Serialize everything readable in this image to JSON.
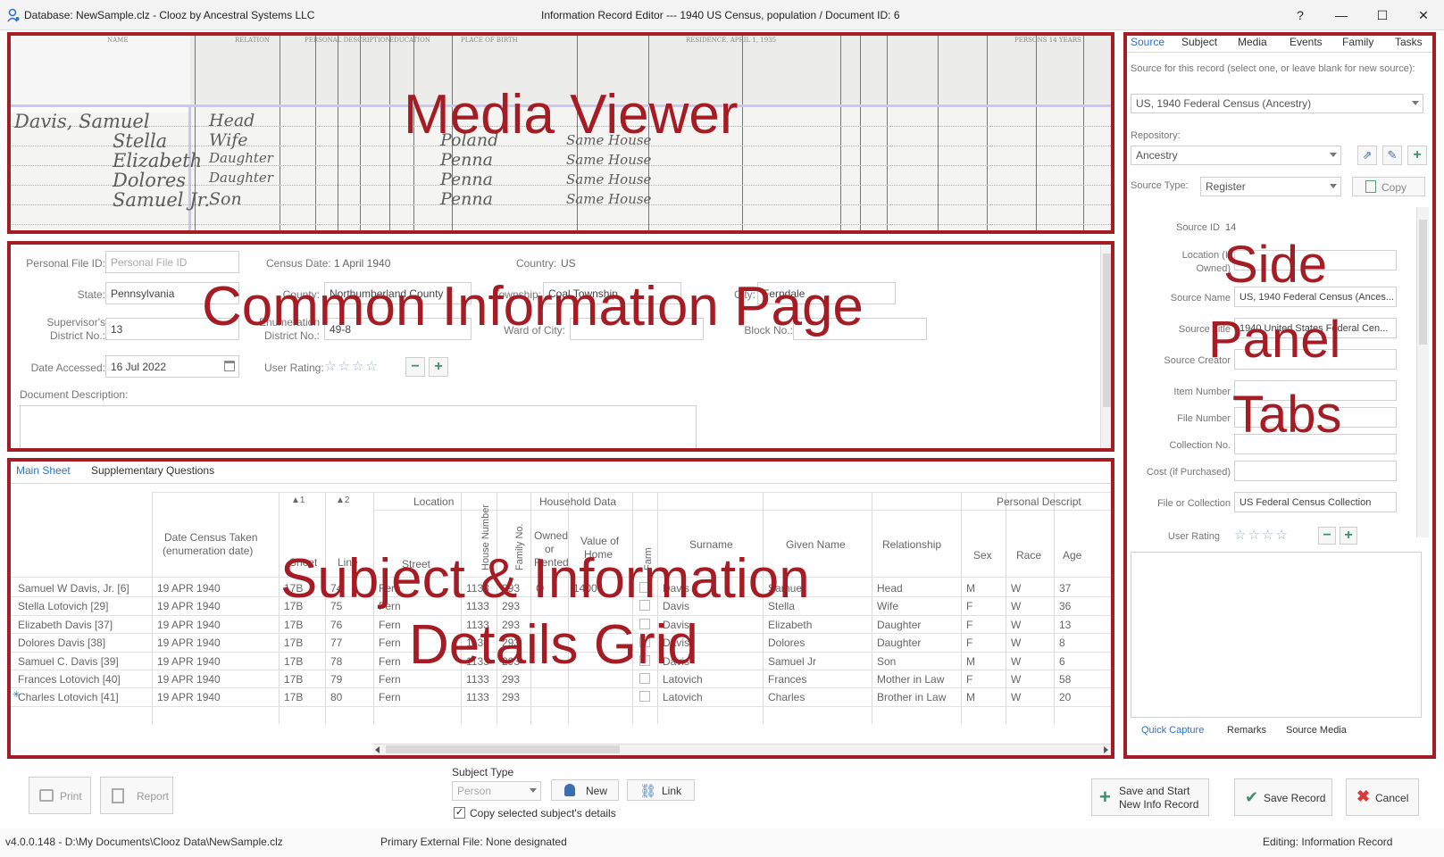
{
  "window": {
    "left_title": "Database: NewSample.clz - Clooz by Ancestral Systems LLC",
    "center_title": "Information Record Editor --- 1940 US Census, population /  Document ID: 6",
    "help": "?",
    "minimize": "—",
    "maximize": "☐",
    "close": "✕"
  },
  "overlays": {
    "media_viewer": "Media Viewer",
    "common_info": "Common Information Page",
    "grid_line1": "Subject & Information",
    "grid_line2": "Details Grid",
    "side_line1": "Side",
    "side_line2": "Panel",
    "side_line3": "Tabs"
  },
  "census_image": {
    "headers": [
      "NAME",
      "RELATION",
      "PERSONAL DESCRIPTION",
      "EDUCATION",
      "PLACE OF BIRTH",
      "RESIDENCE, APRIL 1, 1935",
      "PERSONS 14 YEARS"
    ],
    "handwriting": [
      "Davis, Samuel",
      "Stella",
      "Elizabeth",
      "Dolores",
      "Samuel Jr.",
      "Head",
      "Wife",
      "Daughter",
      "Daughter",
      "Son",
      "Poland",
      "Penna",
      "Penna",
      "Penna",
      "Same House",
      "Same House",
      "Same House",
      "Same House"
    ]
  },
  "common": {
    "personal_file_label": "Personal File ID:",
    "personal_file_placeholder": "Personal File ID",
    "census_date_label": "Census Date:",
    "census_date_value": "1 April 1940",
    "country_label": "Country:",
    "country_value": "US",
    "state_label": "State:",
    "state_value": "Pennsylvania",
    "county_label": "County:",
    "county_value": "Northumberland County",
    "township_label": "Township:",
    "township_value": "Coal Township",
    "city_label": "City:",
    "city_value": "Ferndale",
    "supervisor_label1": "Supervisor's",
    "supervisor_label2": "District No.:",
    "supervisor_value": "13",
    "enum_label1": "Enumeration",
    "enum_label2": "District No.:",
    "enum_value": "49-8",
    "ward_label": "Ward of City:",
    "block_label": "Block No.:",
    "date_accessed_label": "Date Accessed:",
    "date_accessed_value": "16 Jul 2022",
    "user_rating_label": "User Rating:",
    "rating_stars": "☆☆☆☆",
    "doc_desc_label": "Document Description:"
  },
  "grid": {
    "tabs": [
      "Main Sheet",
      "Supplementary Questions"
    ],
    "group_headers": {
      "location": "Location",
      "household": "Household Data",
      "personal": "Personal Descript"
    },
    "sort_sheet": "▲1",
    "sort_line": "▲2",
    "headers": {
      "date1": "Date Census Taken",
      "date2": "(enumeration date)",
      "sheet": "Sheet",
      "line": "Line",
      "street": "Street",
      "house_number": "House Number",
      "family_no": "Family No.",
      "owned1": "Owned",
      "owned2": "or",
      "owned3": "Rented",
      "value1": "Value of",
      "value2": "Home",
      "farm": "Farm",
      "surname": "Surname",
      "given": "Given Name",
      "relationship": "Relationship",
      "sex": "Sex",
      "race": "Race",
      "age": "Age"
    },
    "rows": [
      {
        "subject": "Samuel W Davis, Jr.  [6]",
        "date": "19 APR 1940",
        "sheet": "17B",
        "line": "74",
        "street": "Fern",
        "house": "1133",
        "family": "293",
        "owned": "O",
        "value": "1400",
        "surname": "Davis",
        "given": "Samuel",
        "relationship": "Head",
        "sex": "M",
        "race": "W",
        "age": "37"
      },
      {
        "subject": "Stella Lotovich  [29]",
        "date": "19 APR 1940",
        "sheet": "17B",
        "line": "75",
        "street": "Fern",
        "house": "1133",
        "family": "293",
        "owned": "",
        "value": "",
        "surname": "Davis",
        "given": "Stella",
        "relationship": "Wife",
        "sex": "F",
        "race": "W",
        "age": "36"
      },
      {
        "subject": "Elizabeth Davis  [37]",
        "date": "19 APR 1940",
        "sheet": "17B",
        "line": "76",
        "street": "Fern",
        "house": "1133",
        "family": "293",
        "owned": "",
        "value": "",
        "surname": "Davis",
        "given": "Elizabeth",
        "relationship": "Daughter",
        "sex": "F",
        "race": "W",
        "age": "13"
      },
      {
        "subject": "Dolores Davis  [38]",
        "date": "19 APR 1940",
        "sheet": "17B",
        "line": "77",
        "street": "Fern",
        "house": "1133",
        "family": "293",
        "owned": "",
        "value": "",
        "surname": "Davis",
        "given": "Dolores",
        "relationship": "Daughter",
        "sex": "F",
        "race": "W",
        "age": "8"
      },
      {
        "subject": "Samuel C. Davis  [39]",
        "date": "19 APR 1940",
        "sheet": "17B",
        "line": "78",
        "street": "Fern",
        "house": "1133",
        "family": "293",
        "owned": "",
        "value": "",
        "surname": "Davis",
        "given": "Samuel Jr",
        "relationship": "Son",
        "sex": "M",
        "race": "W",
        "age": "6"
      },
      {
        "subject": "Frances Lotovich  [40]",
        "date": "19 APR 1940",
        "sheet": "17B",
        "line": "79",
        "street": "Fern",
        "house": "1133",
        "family": "293",
        "owned": "",
        "value": "",
        "surname": "Latovich",
        "given": "Frances",
        "relationship": "Mother in Law",
        "sex": "F",
        "race": "W",
        "age": "58"
      },
      {
        "subject": "Charles Lotovich  [41]",
        "date": "19 APR 1940",
        "sheet": "17B",
        "line": "80",
        "street": "Fern",
        "house": "1133",
        "family": "293",
        "owned": "",
        "value": "",
        "surname": "Latovich",
        "given": "Charles",
        "relationship": "Brother in Law",
        "sex": "M",
        "race": "W",
        "age": "20"
      }
    ]
  },
  "side": {
    "tabs": [
      "Source",
      "Subject",
      "Media",
      "Events",
      "Family",
      "Tasks"
    ],
    "source_prompt": "Source for this record (select one, or leave blank for new source):",
    "source_value": "US, 1940 Federal Census (Ancestry)",
    "repository_label": "Repository:",
    "repository_value": "Ancestry",
    "source_type_label": "Source Type:",
    "source_type_value": "Register",
    "copy_label": "Copy",
    "source_id_label": "Source ID",
    "source_id_value": "14",
    "location_label1": "Location (If",
    "location_label2": "Owned)",
    "source_name_label": "Source Name",
    "source_name_value": "US, 1940 Federal Census (Ances...",
    "source_title_label": "Source Title",
    "source_title_value": "1940 United States Federal Cen...",
    "source_creator_label": "Source Creator",
    "item_number_label": "Item Number",
    "file_number_label": "File Number",
    "collection_label": "Collection No.",
    "cost_label": "Cost (if Purchased)",
    "file_or_collection_label": "File or Collection",
    "file_or_collection_value": "US Federal Census Collection",
    "user_rating_label": "User Rating",
    "rating_stars": "☆☆☆☆",
    "bottom_tabs": [
      "Quick Capture",
      "Remarks",
      "Source Media"
    ]
  },
  "bottom": {
    "print": "Print",
    "report": "Report",
    "subject_type_label": "Subject Type",
    "subject_type_value": "Person",
    "new": "New",
    "link": "Link",
    "copy_details": "Copy selected subject's details",
    "save_start1": "Save and Start",
    "save_start2": "New Info Record",
    "save_record": "Save Record",
    "cancel": "Cancel"
  },
  "status": {
    "version": "v4.0.0.148  -  D:\\My Documents\\Clooz Data\\NewSample.clz",
    "primary_file": "Primary External File: None designated",
    "editing": "Editing: Information Record"
  },
  "colors": {
    "annotation_red": "#a51c24",
    "accent_blue": "#2f73c8",
    "green_plus": "#3f8f6a",
    "cancel_red": "#d83a3a"
  }
}
